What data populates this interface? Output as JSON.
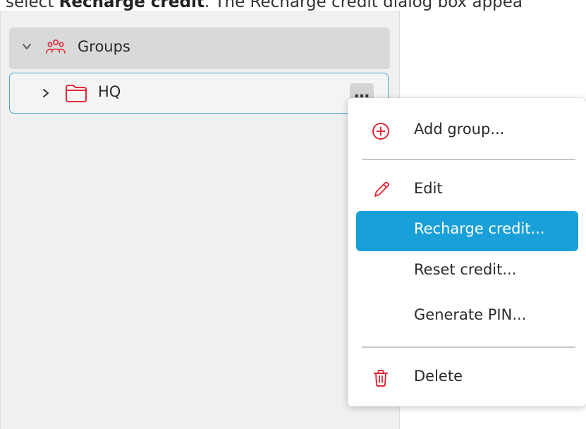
{
  "caption": {
    "before": "select ",
    "bold": "Recharge credit",
    "after": ". The Recharge credit dialog box appea"
  },
  "tree": {
    "root": {
      "label": "Groups",
      "icon": "people-group-icon",
      "expanded": true
    },
    "nodes": [
      {
        "label": "HQ",
        "icon": "folder-icon",
        "expanded": false,
        "selected": true,
        "more_button": "…"
      }
    ]
  },
  "context_menu": {
    "items": [
      {
        "label": "Add group...",
        "icon": "add-circle-icon"
      },
      {
        "label": "Edit",
        "icon": "pencil-icon"
      },
      {
        "label": "Recharge credit...",
        "icon": "",
        "highlighted": true
      },
      {
        "label": "Reset credit...",
        "icon": ""
      },
      {
        "label": "Generate PIN...",
        "icon": ""
      },
      {
        "label": "Delete",
        "icon": "trash-icon"
      }
    ]
  },
  "colors": {
    "accent_red": "#e0283a",
    "highlight_blue": "#1aa0d8",
    "selection_border": "#4aa3d6"
  }
}
